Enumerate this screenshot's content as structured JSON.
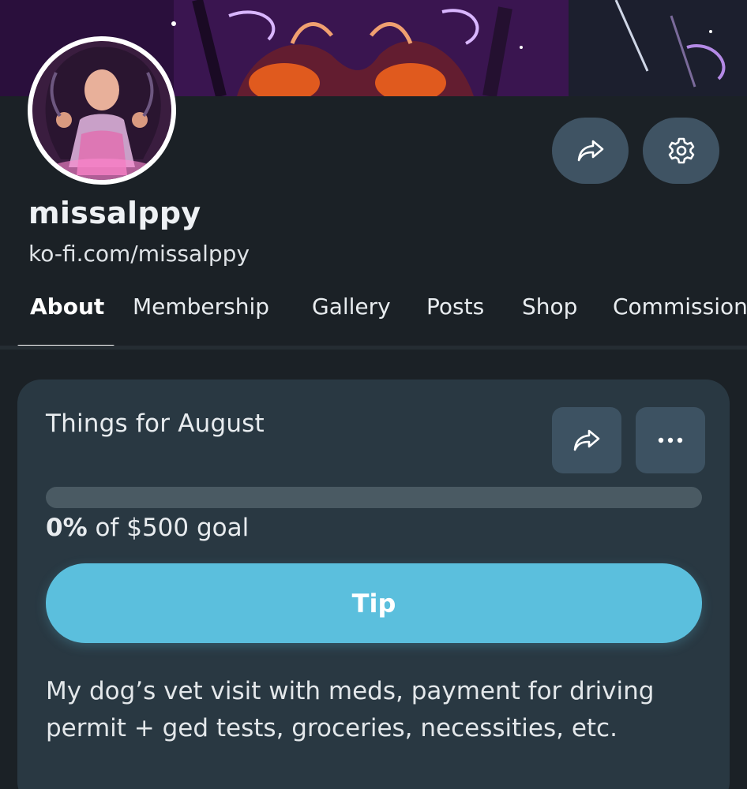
{
  "profile": {
    "username": "missalppy",
    "url": "ko-fi.com/missalppy"
  },
  "header_actions": {
    "share_icon": "share-icon",
    "settings_icon": "gear-icon"
  },
  "tabs": [
    {
      "label": "About",
      "active": true
    },
    {
      "label": "Membership",
      "active": false
    },
    {
      "label": "Gallery",
      "active": false
    },
    {
      "label": "Posts",
      "active": false
    },
    {
      "label": "Shop",
      "active": false
    },
    {
      "label": "Commissions",
      "active": false
    }
  ],
  "goal": {
    "title": "Things for August",
    "percent_label": "0%",
    "goal_suffix": " of $500 goal",
    "progress_fraction": 0,
    "tip_label": "Tip",
    "description": "My dog’s vet visit with meds, payment for driving permit + ged tests, groceries, necessities, etc.",
    "share_icon": "share-icon",
    "more_icon": "more-horizontal-icon"
  },
  "colors": {
    "background": "#1b2126",
    "card": "#293842",
    "button": "#3f5363",
    "accent": "#5bbfdd"
  }
}
